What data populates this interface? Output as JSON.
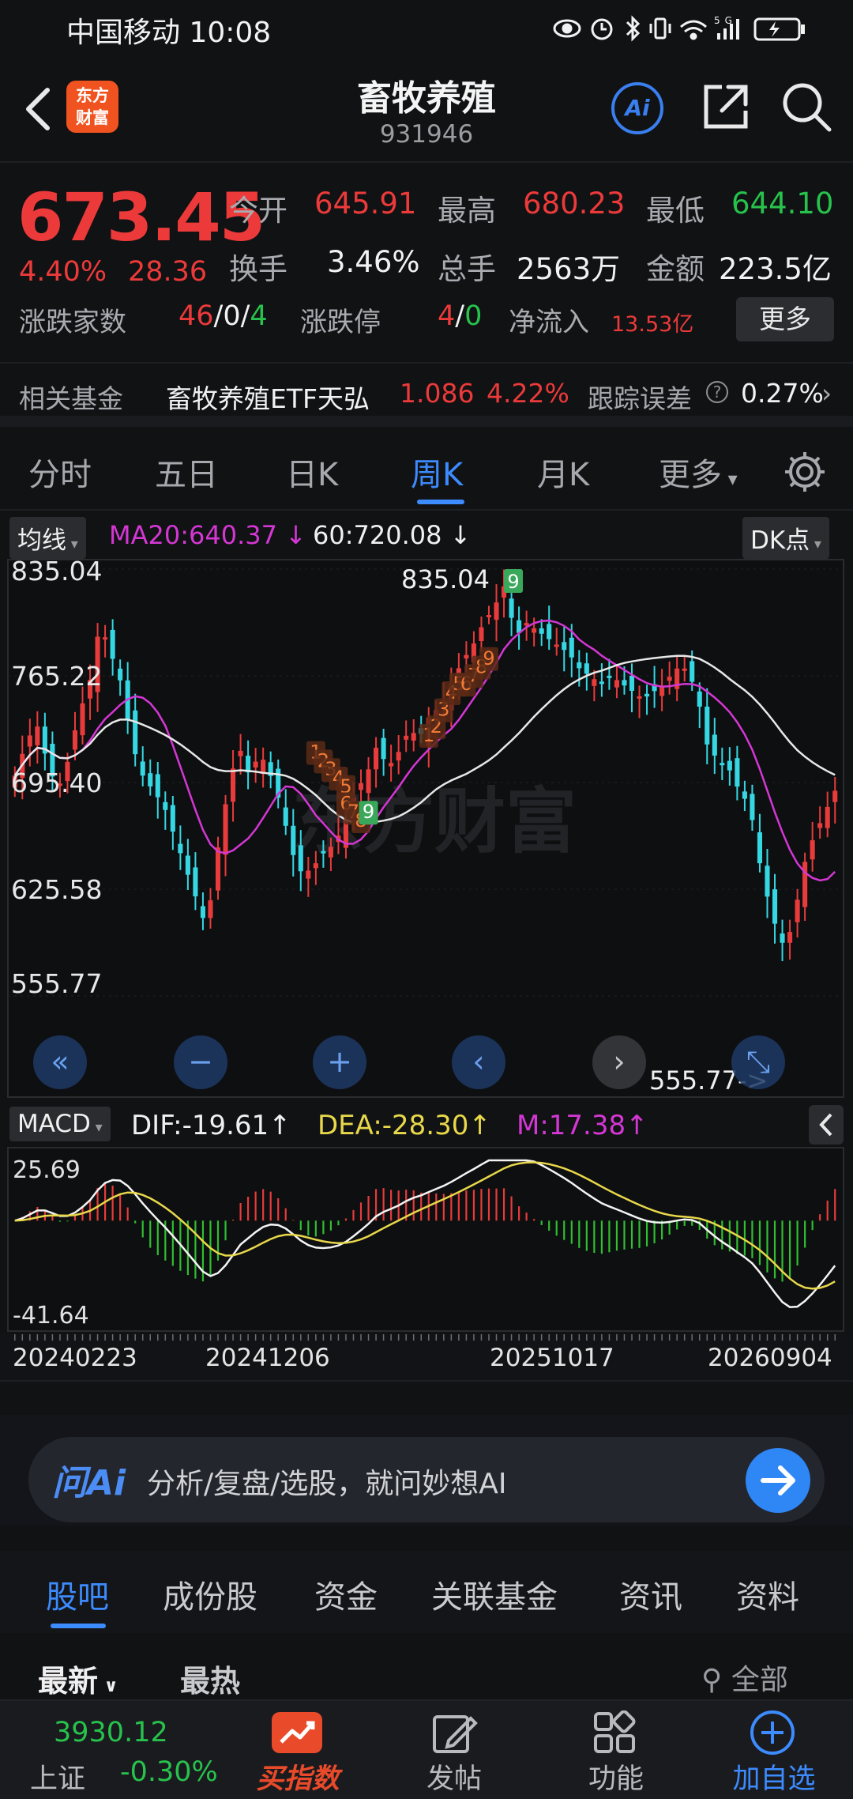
{
  "status": {
    "carrier": "中国移动 10:08",
    "icons": [
      "eye-icon",
      "alarm-icon",
      "bluetooth-icon",
      "vibrate-icon",
      "wifi-icon",
      "5g-signal-icon",
      "battery-icon"
    ],
    "network": "5G"
  },
  "header": {
    "logo_line1": "东方",
    "logo_line2": "财富",
    "title": "畜牧养殖",
    "code": "931946",
    "ai_label": "Ai"
  },
  "quote": {
    "price": "673.45",
    "pct": "4.40%",
    "change": "28.36",
    "open_label": "今开",
    "open": "645.91",
    "high_label": "最高",
    "high": "680.23",
    "low_label": "最低",
    "low": "644.10",
    "turnover_label": "换手",
    "turnover": "3.46%",
    "volume_label": "总手",
    "volume": "2563万",
    "amount_label": "金额",
    "amount": "223.5亿",
    "breadth_label": "涨跌家数",
    "breadth_up": "46",
    "breadth_sep1": "/",
    "breadth_flat": "0",
    "breadth_sep2": "/",
    "breadth_down": "4",
    "limit_label": "涨跌停",
    "limit_up": "4",
    "limit_sep": "/",
    "limit_down": "0",
    "netflow_label": "净流入",
    "netflow": "13.53亿",
    "more_label": "更多"
  },
  "fund": {
    "label": "相关基金",
    "name": "畜牧养殖ETF天弘",
    "price": "1.086",
    "pct": "4.22%",
    "tracking_label": "跟踪误差",
    "tracking_value": "0.27%"
  },
  "period_tabs": [
    "分时",
    "五日",
    "日K",
    "周K",
    "月K",
    "更多"
  ],
  "active_tab": "周K",
  "ma": {
    "chip": "均线",
    "ma20": "MA20:640.37 ↓",
    "ma60": "60:720.08 ↓",
    "dk_chip": "DK点"
  },
  "chart_data": {
    "type": "candlestick",
    "yaxis_labels": [
      "835.04",
      "765.22",
      "695.40",
      "625.58",
      "555.77"
    ],
    "ylim": [
      555.77,
      835.04
    ],
    "high_annotation": "835.04",
    "low_annotation": "555.77->",
    "td_labels": [
      "1",
      "2",
      "3",
      "4",
      "5",
      "6",
      "7",
      "8",
      "9",
      "1",
      "2",
      "3",
      "4",
      "5",
      "6",
      "7",
      "8",
      "9"
    ],
    "colors": {
      "up": "#e83b3b",
      "down": "#35d7e3",
      "ma20": "#d437d4",
      "ma60": "#e8e8e8",
      "td": "#f07a36",
      "td9": "#3aa85a"
    },
    "watermark": "东方财富"
  },
  "macd": {
    "chip": "MACD",
    "dif": "DIF:-19.61↑",
    "dea": "DEA:-28.30↑",
    "m": "M:17.38↑",
    "ymax_label": "25.69",
    "ymin_label": "-41.64"
  },
  "dates": [
    "20240223",
    "20241206",
    "20251017",
    "20260904"
  ],
  "ai_bar": {
    "logo": "问Ai",
    "prompt": "分析/复盘/选股，就问妙想AI"
  },
  "section_tabs": [
    "股吧",
    "成份股",
    "资金",
    "关联基金",
    "资讯",
    "资料"
  ],
  "active_section": "股吧",
  "sort": {
    "latest": "最新",
    "hot": "最热",
    "filter": "全部"
  },
  "bottom_nav": {
    "index_value": "3930.12",
    "index_name": "上证",
    "index_pct": "-0.30%",
    "buy_index": "买指数",
    "post": "发帖",
    "features": "功能",
    "add_watch": "加自选"
  }
}
